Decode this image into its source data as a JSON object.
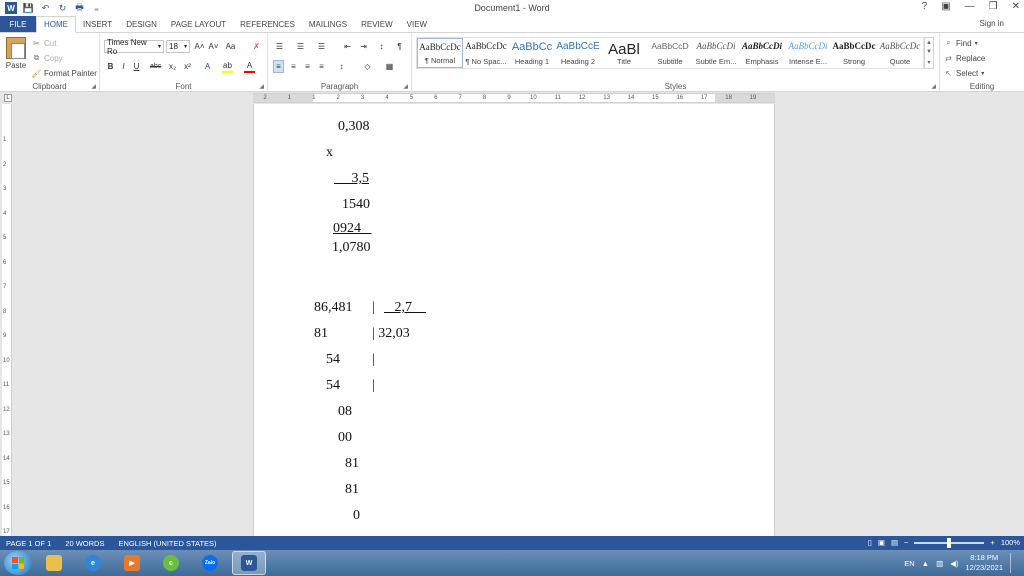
{
  "window": {
    "title": "Document1 - Word",
    "help": "?",
    "ribbon_options": "▣",
    "minimize": "—",
    "restore": "❐",
    "close": "✕"
  },
  "qat": {
    "logo": "W",
    "save": "💾",
    "undo": "↶",
    "redo": "↻",
    "preview": "🖶",
    "customize": "₌"
  },
  "tabs": {
    "file": "FILE",
    "items": [
      "HOME",
      "INSERT",
      "DESIGN",
      "PAGE LAYOUT",
      "REFERENCES",
      "MAILINGS",
      "REVIEW",
      "VIEW"
    ],
    "signin": "Sign in"
  },
  "clipboard": {
    "paste": "Paste",
    "cut": "Cut",
    "copy": "Copy",
    "format_painter": "Format Painter",
    "label": "Clipboard"
  },
  "font": {
    "name": "Times New Ro",
    "size": "18",
    "label": "Font",
    "grow": "A˄",
    "shrink": "A˅",
    "case": "Aa",
    "clear": "✗",
    "bold": "B",
    "italic": "I",
    "underline": "U",
    "strike": "abc",
    "subscript": "x₂",
    "superscript": "x²",
    "effects": "A",
    "highlight": "ab",
    "color": "A"
  },
  "paragraph": {
    "label": "Paragraph",
    "bullets": "☰",
    "numbering": "☰",
    "multilevel": "☰",
    "decrease_indent": "⇤",
    "increase_indent": "⇥",
    "sort": "↕",
    "show_marks": "¶",
    "align_left": "≡",
    "center": "≡",
    "align_right": "≡",
    "justify": "≡",
    "line_spacing": "↕",
    "shading": "◇",
    "borders": "▦"
  },
  "styles": {
    "label": "Styles",
    "items": [
      {
        "preview": "AaBbCcDc",
        "name": "¶ Normal"
      },
      {
        "preview": "AaBbCcDc",
        "name": "¶ No Spac..."
      },
      {
        "preview": "AaBbCc",
        "name": "Heading 1"
      },
      {
        "preview": "AaBbCcE",
        "name": "Heading 2"
      },
      {
        "preview": "AaBl",
        "name": "Title"
      },
      {
        "preview": "AaBbCcD",
        "name": "Subtitle"
      },
      {
        "preview": "AaBbCcDi",
        "name": "Subtle Em..."
      },
      {
        "preview": "AaBbCcDi",
        "name": "Emphasis"
      },
      {
        "preview": "AaBbCcDi",
        "name": "Intense E..."
      },
      {
        "preview": "AaBbCcDc",
        "name": "Strong"
      },
      {
        "preview": "AaBbCcDc",
        "name": "Quote"
      }
    ],
    "scroll_up": "▲",
    "scroll_down": "▼",
    "more": "▾"
  },
  "editing": {
    "label": "Editing",
    "find": "Find",
    "replace": "Replace",
    "select": "Select"
  },
  "ruler": {
    "corner": "L",
    "ticks": [
      "2",
      "1",
      "1",
      "2",
      "3",
      "4",
      "5",
      "6",
      "7",
      "8",
      "9",
      "10",
      "11",
      "12",
      "13",
      "14",
      "15",
      "16",
      "17",
      "18",
      "19"
    ],
    "vticks": [
      "1",
      "2",
      "3",
      "4",
      "5",
      "6",
      "7",
      "8",
      "9",
      "10",
      "11",
      "12",
      "13",
      "14",
      "15",
      "16",
      "17"
    ]
  },
  "document": {
    "lines": [
      {
        "text": "0,308",
        "underline": false
      },
      {
        "text": "x",
        "underline": false
      },
      {
        "text": "     3,5",
        "underline": true
      },
      {
        "text": "1540",
        "underline": false
      },
      {
        "text": "0924   ",
        "underline": true
      },
      {
        "text": "1,0780",
        "underline": false
      },
      {
        "text": "86,481",
        "underline": false
      },
      {
        "text": "|",
        "underline": false
      },
      {
        "text": "   2,7    ",
        "underline": true
      },
      {
        "text": "81",
        "underline": false
      },
      {
        "text": "| 32,03",
        "underline": false
      },
      {
        "text": "54",
        "underline": false
      },
      {
        "text": "|",
        "underline": false
      },
      {
        "text": "54",
        "underline": false
      },
      {
        "text": "|",
        "underline": false
      },
      {
        "text": "08",
        "underline": false
      },
      {
        "text": "00",
        "underline": false
      },
      {
        "text": "81",
        "underline": false
      },
      {
        "text": "81",
        "underline": false
      },
      {
        "text": "0",
        "underline": false
      }
    ]
  },
  "statusbar": {
    "page": "PAGE 1 OF 1",
    "words": "20 WORDS",
    "language": "ENGLISH (UNITED STATES)",
    "zoom_minus": "−",
    "zoom_plus": "+",
    "zoom": "100%",
    "zoom_level": 0.5
  },
  "taskbar": {
    "tray_lang": "EN",
    "time": "8:18 PM",
    "date": "12/23/2021",
    "zalo": "Zalo",
    "word": "W"
  }
}
